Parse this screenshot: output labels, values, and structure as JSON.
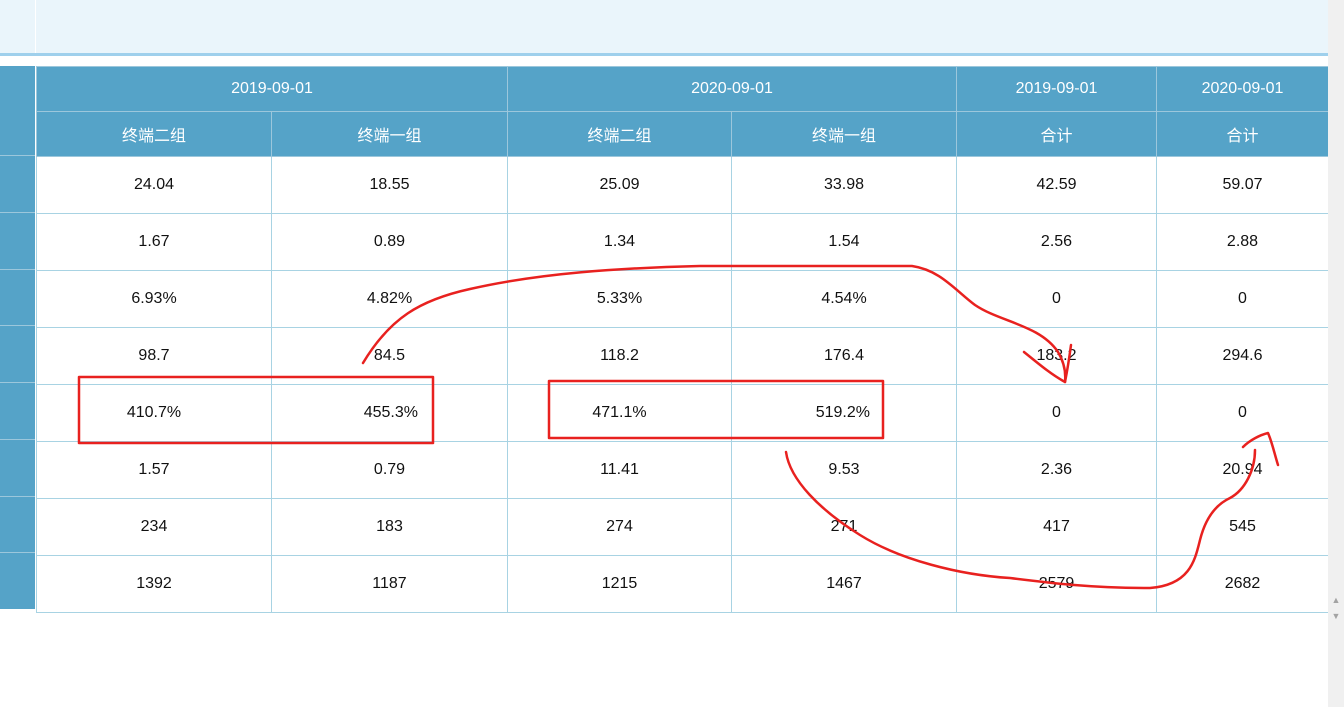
{
  "header": {
    "date_groups": [
      {
        "label": "2019-09-01"
      },
      {
        "label": "2020-09-01"
      },
      {
        "label": "2019-09-01"
      },
      {
        "label": "2020-09-01"
      }
    ],
    "columns": [
      "终端二组",
      "终端一组",
      "终端二组",
      "终端一组",
      "合计",
      "合计"
    ]
  },
  "rows": [
    [
      "24.04",
      "18.55",
      "25.09",
      "33.98",
      "42.59",
      "59.07"
    ],
    [
      "1.67",
      "0.89",
      "1.34",
      "1.54",
      "2.56",
      "2.88"
    ],
    [
      "6.93%",
      "4.82%",
      "5.33%",
      "4.54%",
      "0",
      "0"
    ],
    [
      "98.7",
      "84.5",
      "118.2",
      "176.4",
      "183.2",
      "294.6"
    ],
    [
      "410.7%",
      "455.3%",
      "471.1%",
      "519.2%",
      "0",
      "0"
    ],
    [
      "1.57",
      "0.79",
      "11.41",
      "9.53",
      "2.36",
      "20.94"
    ],
    [
      "234",
      "183",
      "274",
      "271",
      "417",
      "545"
    ],
    [
      "1392",
      "1187",
      "1215",
      "1467",
      "2579",
      "2682"
    ]
  ],
  "annotation_color": "#e8211f",
  "scrollbar": {
    "up_icon": "triangle-up-icon",
    "down_icon": "triangle-down-icon"
  }
}
